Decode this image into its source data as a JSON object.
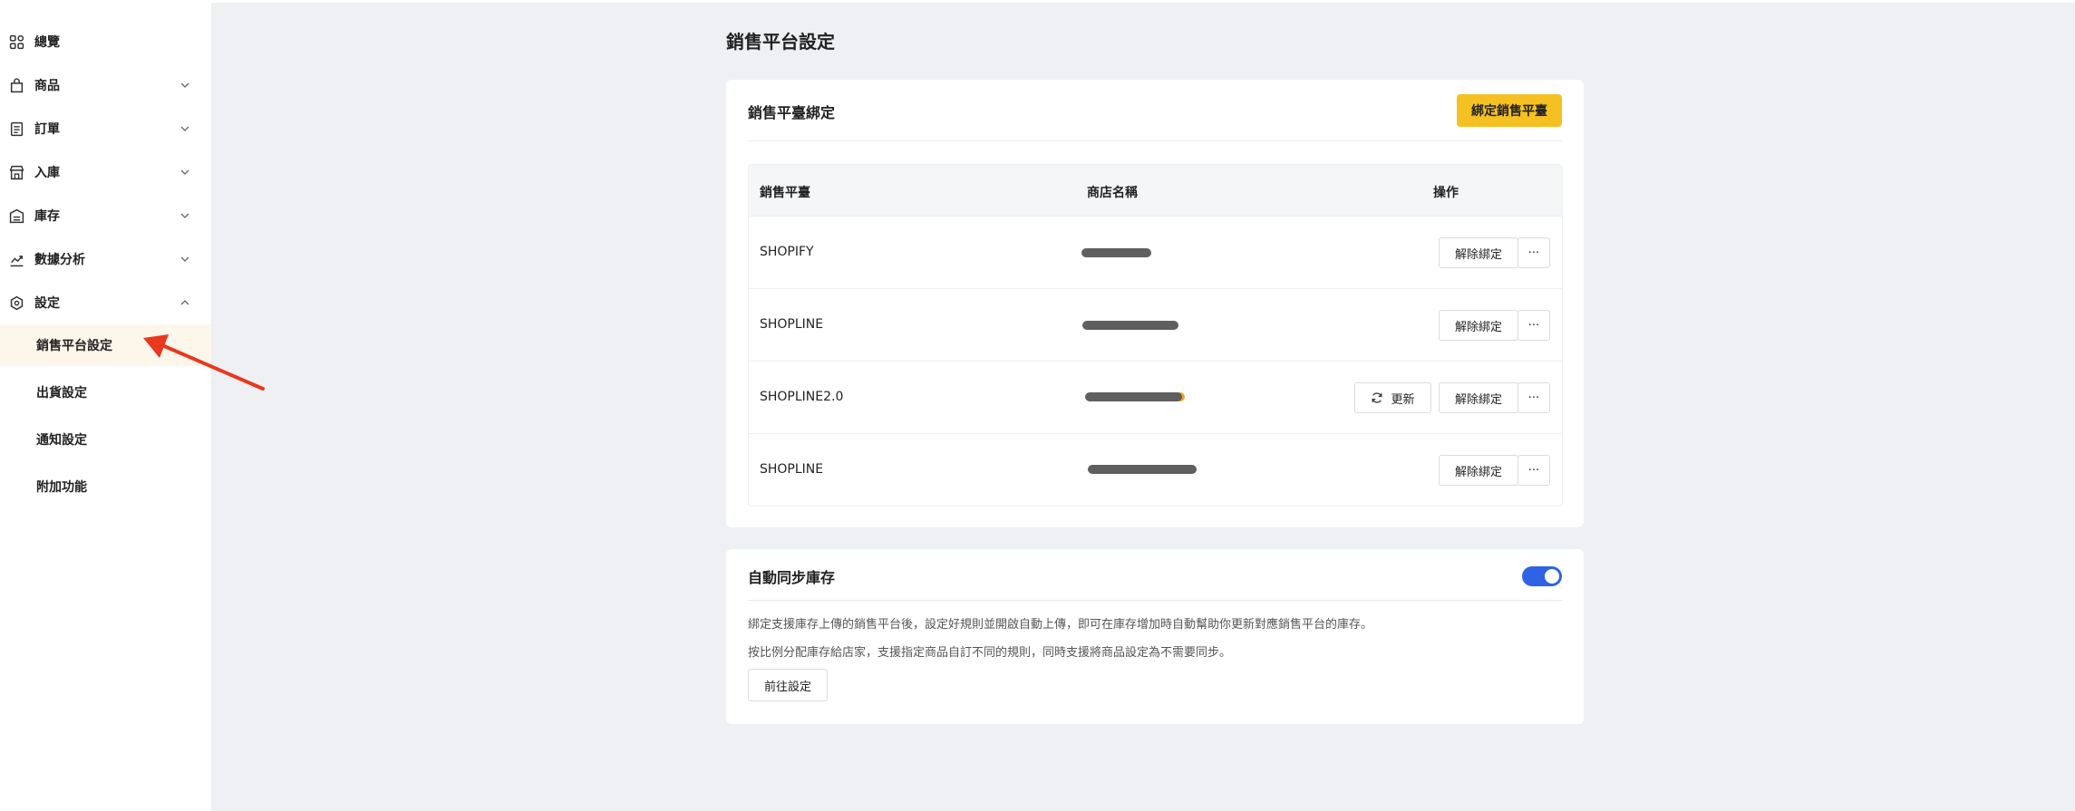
{
  "sidebar": {
    "items": [
      {
        "label": "總覽",
        "icon": "dashboard-icon",
        "has_chevron": false
      },
      {
        "label": "商品",
        "icon": "bag-icon",
        "has_chevron": true
      },
      {
        "label": "訂單",
        "icon": "receipt-icon",
        "has_chevron": true
      },
      {
        "label": "入庫",
        "icon": "store-icon",
        "has_chevron": true
      },
      {
        "label": "庫存",
        "icon": "warehouse-icon",
        "has_chevron": true
      },
      {
        "label": "數據分析",
        "icon": "analytics-icon",
        "has_chevron": true
      },
      {
        "label": "設定",
        "icon": "settings-icon",
        "has_chevron": true,
        "expanded": true
      }
    ],
    "settings_sub": [
      {
        "label": "銷售平台設定",
        "active": true
      },
      {
        "label": "出貨設定",
        "active": false
      },
      {
        "label": "通知設定",
        "active": false
      },
      {
        "label": "附加功能",
        "active": false
      }
    ]
  },
  "main": {
    "page_title": "銷售平台設定",
    "binding_card": {
      "title": "銷售平臺綁定",
      "bind_button": "綁定銷售平臺",
      "columns": [
        "銷售平臺",
        "商店名稱",
        "操作"
      ],
      "rows": [
        {
          "platform": "SHOPIFY",
          "store_name_redacted": true,
          "actions": [
            "解除綁定",
            "···"
          ]
        },
        {
          "platform": "SHOPLINE",
          "store_name_redacted": true,
          "actions": [
            "解除綁定",
            "···"
          ]
        },
        {
          "platform": "SHOPLINE2.0",
          "store_name_redacted": true,
          "actions": [
            "更新",
            "解除綁定",
            "···"
          ]
        },
        {
          "platform": "SHOPLINE",
          "store_name_redacted": true,
          "actions": [
            "解除綁定",
            "···"
          ]
        }
      ],
      "update_label": "更新",
      "unbind_label": "解除綁定",
      "more_label": "···"
    },
    "sync_card": {
      "title": "自動同步庫存",
      "toggle_on": true,
      "desc1": "綁定支援庫存上傳的銷售平台後，設定好規則並開啟自動上傳，即可在庫存增加時自動幫助你更新對應銷售平台的庫存。",
      "desc2": "按比例分配庫存給店家，支援指定商品自訂不同的規則，同時支援將商品設定為不需要同步。",
      "goto_button": "前往設定"
    }
  },
  "colors": {
    "accent_yellow": "#f5c122",
    "toggle_blue": "#2f63e6",
    "annotation_red": "#e8381e",
    "active_bg": "#fdf6ea"
  }
}
